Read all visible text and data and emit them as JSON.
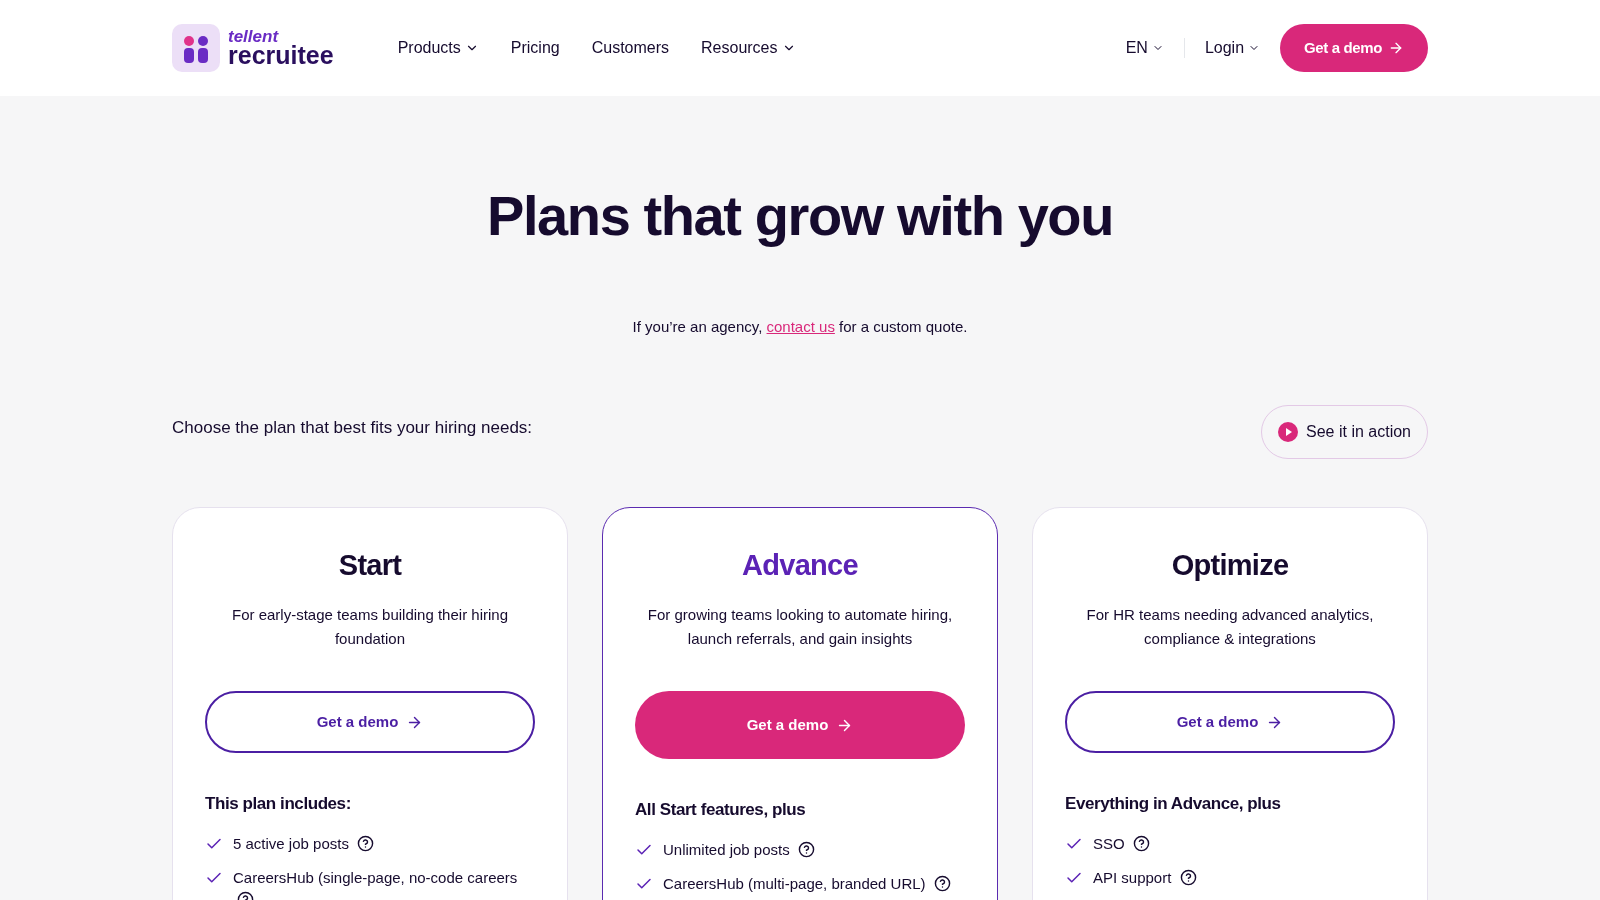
{
  "header": {
    "logo": {
      "brand": "tellent",
      "product": "recruitee"
    },
    "nav": [
      {
        "label": "Products",
        "dropdown": true
      },
      {
        "label": "Pricing",
        "dropdown": false
      },
      {
        "label": "Customers",
        "dropdown": false
      },
      {
        "label": "Resources",
        "dropdown": true
      }
    ],
    "language": "EN",
    "login": "Login",
    "cta": "Get a demo"
  },
  "hero": {
    "title": "Plans that grow with you",
    "note": {
      "before": "If you’re an agency,",
      "link": "contact us",
      "after": "for a custom quote."
    }
  },
  "intro": "Choose the plan that best fits your hiring needs:",
  "video_button": "See it in action",
  "plans": [
    {
      "name": "Start",
      "highlighted": false,
      "description": "For early-stage teams building their hiring foundation",
      "button": "Get a demo",
      "features_heading": "This plan includes:",
      "features": [
        "5 active job posts",
        "CareersHub (single-page, no-code careers"
      ]
    },
    {
      "name": "Advance",
      "highlighted": true,
      "description": "For growing teams looking to automate hiring, launch referrals, and gain insights",
      "button": "Get a demo",
      "features_heading": "All Start features, plus",
      "features": [
        "Unlimited job posts",
        "CareersHub (multi-page, branded URL)"
      ]
    },
    {
      "name": "Optimize",
      "highlighted": false,
      "description": "For HR teams needing advanced analytics, compliance & integrations",
      "button": "Get a demo",
      "features_heading": "Everything in Advance, plus",
      "features": [
        "SSO",
        "API support"
      ]
    }
  ]
}
